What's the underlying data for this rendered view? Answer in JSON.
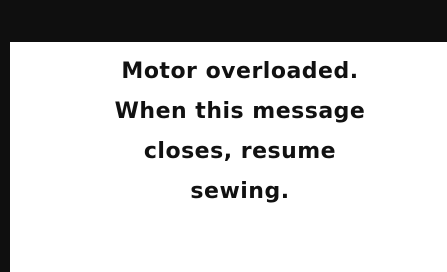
{
  "dialog": {
    "message_lines": [
      "Motor overloaded.",
      "When this message",
      "closes, resume",
      "sewing."
    ]
  },
  "colors": {
    "title_bar": "#0f0f0f",
    "background": "#ffffff",
    "text": "#111111"
  }
}
